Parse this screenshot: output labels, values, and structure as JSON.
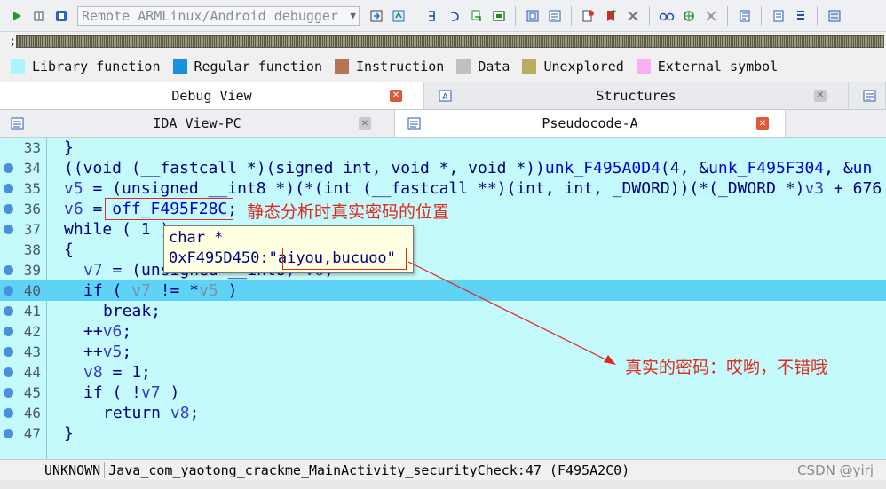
{
  "toolbar": {
    "debugger_select": "Remote ARMLinux/Android debugger",
    "icons": [
      "play-icon",
      "pause-icon",
      "stop-icon",
      "step-into-icon",
      "step-over-icon",
      "run-to-cursor-icon",
      "step-out-icon",
      "return-icon",
      "window-icon",
      "copy-window-icon",
      "add-breakpoint-icon",
      "bookmark-icon",
      "tools-icon",
      "watch-icon",
      "share-icon",
      "settings-icon",
      "list-icon",
      "export-icon",
      "stack-icon"
    ]
  },
  "legend": [
    {
      "label": "Library function",
      "color": "#a8f5fb"
    },
    {
      "label": "Regular function",
      "color": "#1a90e0"
    },
    {
      "label": "Instruction",
      "color": "#b67656"
    },
    {
      "label": "Data",
      "color": "#c0c0c0"
    },
    {
      "label": "Unexplored",
      "color": "#b8ae62"
    },
    {
      "label": "External symbol",
      "color": "#f8aff5"
    }
  ],
  "tabs_row1": {
    "debug_view": "Debug View",
    "structures": "Structures"
  },
  "tabs_row2": {
    "ida_view": "IDA View-PC",
    "pseudocode": "Pseudocode-A"
  },
  "code": {
    "line_numbers": [
      "33",
      "34",
      "35",
      "36",
      "37",
      "38",
      "39",
      "40",
      "41",
      "42",
      "43",
      "44",
      "45",
      "46",
      "47"
    ],
    "l33": "}",
    "l34_a": "((void (__fastcall *)(signed int, void *, void *))",
    "l34_b": "unk_F495A0D4",
    "l34_c": "(4, &",
    "l34_d": "unk_F495F304",
    "l34_e": ", &",
    "l34_f": "un",
    "l35_a": "v5",
    "l35_b": " = (unsigned __int8 *)(*(int (__fastcall **)(int, int, _DWORD))(*(_DWORD *)",
    "l35_c": "v3",
    "l35_d": " + 676",
    "l36_a": "v6",
    "l36_b": " = ",
    "l36_c": "off_F495F28C",
    "l36_d": ";",
    "l37": "while ( 1 )",
    "l38": "{",
    "l39_a": "v7",
    "l39_b": " = (unsigned __int8) ",
    "l39_c": "v6",
    "l39_d": ";",
    "l40_a": "if ( ",
    "l40_b": "v7",
    "l40_c": " != *",
    "l40_d": "v5",
    "l40_e": " )",
    "l41": "break;",
    "l42_a": "++",
    "l42_b": "v6",
    "l42_c": ";",
    "l43_a": "++",
    "l43_b": "v5",
    "l43_c": ";",
    "l44_a": "v8",
    "l44_b": " = 1;",
    "l45_a": "if ( !",
    "l45_b": "v7",
    "l45_c": " )",
    "l46_a": "return ",
    "l46_b": "v8",
    "l46_c": ";",
    "l47": "}"
  },
  "tooltip": {
    "type": "char *",
    "address": "0xF495D450:",
    "quote_open": "\"",
    "value": "aiyou,bucuoo",
    "quote_close": "\""
  },
  "annotations": {
    "static_location": "静态分析时真实密码的位置",
    "real_password": "真实的密码：哎哟，不错哦"
  },
  "statusbar": {
    "state": "UNKNOWN",
    "location": "Java_com_yaotong_crackme_MainActivity_securityCheck:47",
    "address": "(F495A2C0)",
    "watermark": "CSDN @yirj"
  }
}
